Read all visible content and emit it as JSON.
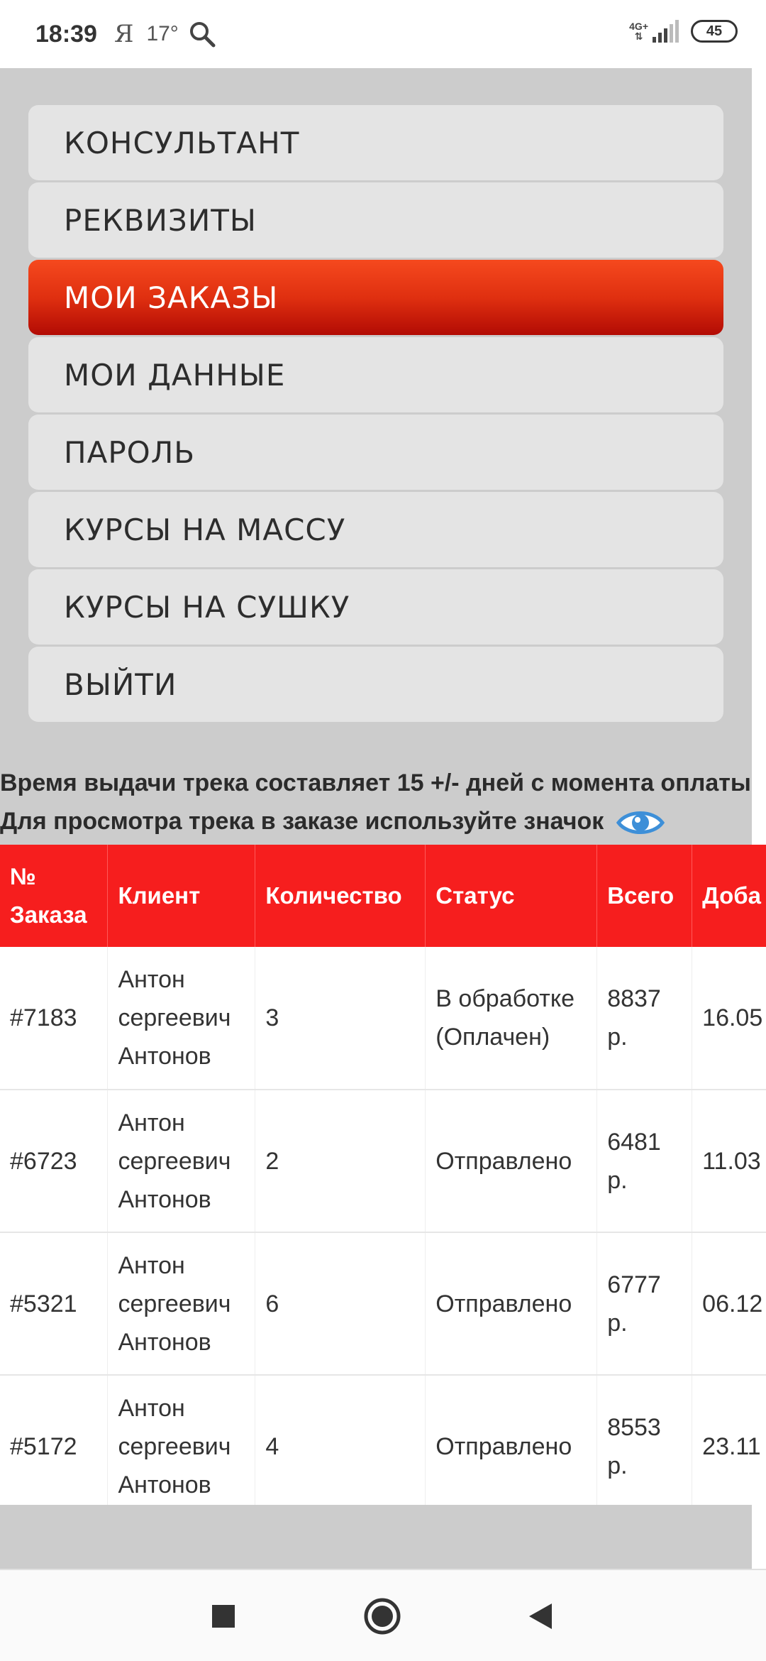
{
  "status_bar": {
    "time": "18:39",
    "yandex": "Я",
    "temperature": "17°",
    "network": "4G+",
    "battery": "45"
  },
  "menu": {
    "items": [
      {
        "label": "КОНСУЛЬТАНТ",
        "active": false
      },
      {
        "label": "РЕКВИЗИТЫ",
        "active": false
      },
      {
        "label": "МОИ ЗАКАЗЫ",
        "active": true
      },
      {
        "label": "МОИ ДАННЫЕ",
        "active": false
      },
      {
        "label": "ПАРОЛЬ",
        "active": false
      },
      {
        "label": "КУРСЫ НА МАССУ",
        "active": false
      },
      {
        "label": "КУРСЫ НА СУШКУ",
        "active": false
      },
      {
        "label": "ВЫЙТИ",
        "active": false
      }
    ]
  },
  "info": {
    "line1": "Время выдачи трека составляет 15 +/- дней с момента оплаты",
    "line2": "Для просмотра трека в заказе используйте значок"
  },
  "orders_table": {
    "headers": [
      "№ Заказа",
      "Клиент",
      "Количество",
      "Статус",
      "Всего",
      "Доба"
    ],
    "rows": [
      {
        "order": "#7183",
        "client": "Антон сергеевич Антонов",
        "qty": "3",
        "status": "В обработке (Оплачен)",
        "total": "8837 р.",
        "date": "16.05"
      },
      {
        "order": "#6723",
        "client": "Антон сергеевич Антонов",
        "qty": "2",
        "status": "Отправлено",
        "total": "6481 р.",
        "date": "11.03"
      },
      {
        "order": "#5321",
        "client": "Антон сергеевич Антонов",
        "qty": "6",
        "status": "Отправлено",
        "total": "6777 р.",
        "date": "06.12"
      },
      {
        "order": "#5172",
        "client": "Антон сергеевич Антонов",
        "qty": "4",
        "status": "Отправлено",
        "total": "8553 р.",
        "date": "23.11"
      }
    ]
  },
  "colors": {
    "accent_red": "#f61e1e",
    "active_menu": "#e03010",
    "eye_icon": "#3d8fd8"
  },
  "nav": {
    "recent_icon": "square-icon",
    "home_icon": "circle-icon",
    "back_icon": "triangle-back-icon"
  }
}
